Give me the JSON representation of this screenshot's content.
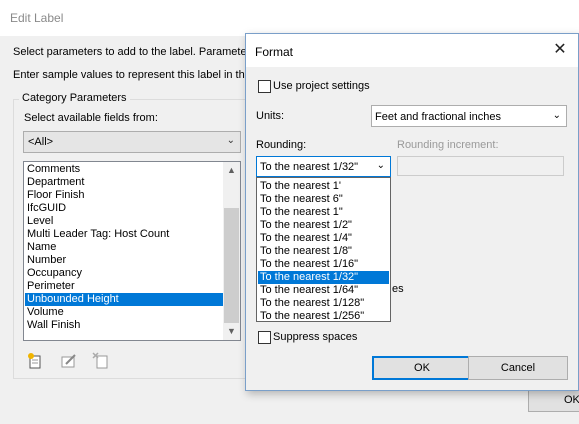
{
  "back_dialog": {
    "title": "Edit Label",
    "instruction1": "Select parameters to add to the label.  Paramete",
    "instruction2": "Enter sample values to represent this label in the",
    "group_title": "Category Parameters",
    "select_label": "Select available fields from:",
    "filter_value": "<All>",
    "fields": [
      {
        "label": "Comments",
        "selected": false
      },
      {
        "label": "Department",
        "selected": false
      },
      {
        "label": "Floor Finish",
        "selected": false
      },
      {
        "label": "IfcGUID",
        "selected": false
      },
      {
        "label": "Level",
        "selected": false
      },
      {
        "label": "Multi Leader Tag: Host Count",
        "selected": false
      },
      {
        "label": "Name",
        "selected": false
      },
      {
        "label": "Number",
        "selected": false
      },
      {
        "label": "Occupancy",
        "selected": false
      },
      {
        "label": "Perimeter",
        "selected": false
      },
      {
        "label": "Unbounded Height",
        "selected": true
      },
      {
        "label": "Volume",
        "selected": false
      },
      {
        "label": "Wall Finish",
        "selected": false
      }
    ],
    "ok_label": "OK",
    "icons": [
      "add-parameter-icon",
      "edit-parameter-icon",
      "delete-parameter-icon"
    ]
  },
  "format_dialog": {
    "title": "Format",
    "use_project_settings_label": "Use project settings",
    "use_project_settings_checked": false,
    "units_label": "Units:",
    "units_value": "Feet and fractional inches",
    "rounding_label": "Rounding:",
    "rounding_value": "To the nearest 1/32\"",
    "rounding_increment_label": "Rounding increment:",
    "rounding_options": [
      {
        "label": "To the nearest 1'",
        "selected": false
      },
      {
        "label": "To the nearest 6\"",
        "selected": false
      },
      {
        "label": "To the nearest 1\"",
        "selected": false
      },
      {
        "label": "To the nearest 1/2\"",
        "selected": false
      },
      {
        "label": "To the nearest 1/4\"",
        "selected": false
      },
      {
        "label": "To the nearest 1/8\"",
        "selected": false
      },
      {
        "label": "To the nearest 1/16\"",
        "selected": false
      },
      {
        "label": "To the nearest 1/32\"",
        "selected": true
      },
      {
        "label": "To the nearest 1/64\"",
        "selected": false
      },
      {
        "label": "To the nearest 1/128\"",
        "selected": false
      },
      {
        "label": "To the nearest 1/256\"",
        "selected": false
      }
    ],
    "partially_hidden_text": "es",
    "suppress_spaces_label": "Suppress spaces",
    "suppress_spaces_checked": false,
    "ok_label": "OK",
    "cancel_label": "Cancel"
  },
  "colors": {
    "selection": "#0078d7",
    "dialog_bg": "#f0f0f0"
  }
}
